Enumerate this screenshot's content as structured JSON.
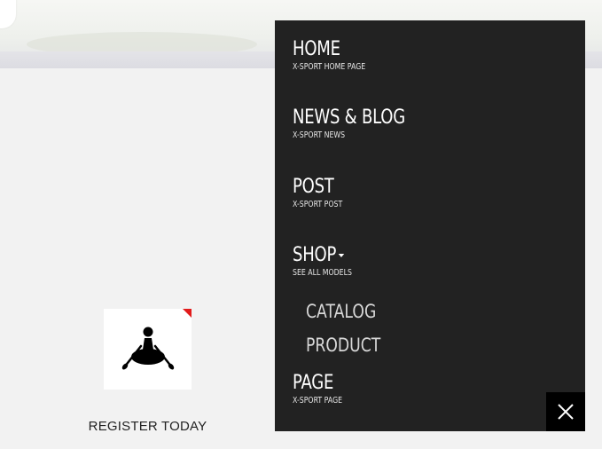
{
  "menu": {
    "items": [
      {
        "title": "HOME",
        "subtitle": "X-SPORT HOME PAGE"
      },
      {
        "title": "NEWS & BLOG",
        "subtitle": "X-SPORT NEWS"
      },
      {
        "title": "POST",
        "subtitle": "X-SPORT POST"
      },
      {
        "title": "SHOP",
        "subtitle": "SEE ALL MODELS",
        "has_dropdown": true,
        "children": [
          {
            "label": "CATALOG"
          },
          {
            "label": "PRODUCT"
          }
        ]
      },
      {
        "title": "PAGE",
        "subtitle": "X-SPORT PAGE"
      }
    ],
    "close_icon": "close-icon"
  },
  "card": {
    "icon": "kayak-paddler-icon",
    "link_label": "REGISTER TODAY",
    "ribbon_color": "#e21b1b"
  },
  "colors": {
    "menu_bg": "#222222",
    "close_bg": "#000000",
    "page_bg": "#f2f2f2"
  }
}
